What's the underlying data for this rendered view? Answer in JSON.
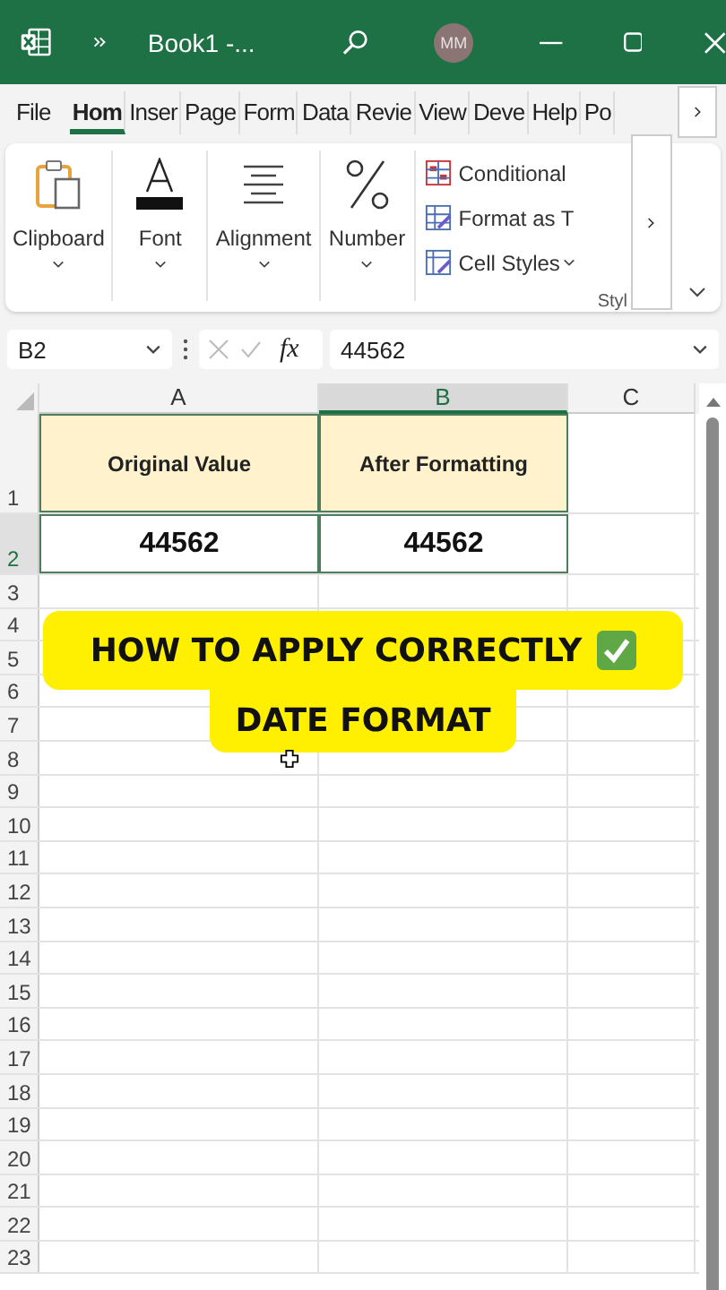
{
  "title_bar": {
    "title": "Book1 -...",
    "avatar": "MM"
  },
  "tabs": [
    {
      "label": "File",
      "selected": false
    },
    {
      "label": "Hom",
      "selected": true
    },
    {
      "label": "Inser",
      "selected": false
    },
    {
      "label": "Page",
      "selected": false
    },
    {
      "label": "Form",
      "selected": false
    },
    {
      "label": "Data",
      "selected": false
    },
    {
      "label": "Revie",
      "selected": false
    },
    {
      "label": "View",
      "selected": false
    },
    {
      "label": "Deve",
      "selected": false
    },
    {
      "label": "Help",
      "selected": false
    },
    {
      "label": "Po",
      "selected": false
    }
  ],
  "ribbon": {
    "groups": [
      {
        "label": "Clipboard",
        "kind": "clipboard"
      },
      {
        "label": "Font",
        "kind": "font"
      },
      {
        "label": "Alignment",
        "kind": "alignment"
      },
      {
        "label": "Number",
        "kind": "number"
      }
    ],
    "styles": {
      "items": [
        {
          "label": "Conditional",
          "kind": "conditional"
        },
        {
          "label": "Format as T",
          "kind": "table"
        },
        {
          "label": "Cell Styles",
          "kind": "cellstyles"
        }
      ],
      "label": "Styl"
    }
  },
  "formula_bar": {
    "name_box": "B2",
    "fx": "fx",
    "value": "44562"
  },
  "grid": {
    "columns": [
      {
        "label": "A",
        "selected": false
      },
      {
        "label": "B",
        "selected": true
      },
      {
        "label": "C",
        "selected": false
      }
    ],
    "rows": [
      {
        "label": "1",
        "kind": "header",
        "selected": false,
        "cells": [
          "Original Value",
          "After Formatting"
        ]
      },
      {
        "label": "2",
        "kind": "value",
        "selected": true,
        "cells": [
          "44562",
          "44562"
        ]
      },
      {
        "label": "3",
        "kind": "empty",
        "selected": false
      },
      {
        "label": "4",
        "kind": "empty",
        "selected": false
      },
      {
        "label": "5",
        "kind": "empty",
        "selected": false
      },
      {
        "label": "6",
        "kind": "empty",
        "selected": false
      },
      {
        "label": "7",
        "kind": "empty",
        "selected": false
      },
      {
        "label": "8",
        "kind": "empty",
        "selected": false
      },
      {
        "label": "9",
        "kind": "empty",
        "selected": false
      },
      {
        "label": "10",
        "kind": "empty",
        "selected": false
      },
      {
        "label": "11",
        "kind": "empty",
        "selected": false
      },
      {
        "label": "12",
        "kind": "empty",
        "selected": false
      },
      {
        "label": "13",
        "kind": "empty",
        "selected": false
      },
      {
        "label": "14",
        "kind": "empty",
        "selected": false
      },
      {
        "label": "15",
        "kind": "empty",
        "selected": false
      },
      {
        "label": "16",
        "kind": "empty",
        "selected": false
      },
      {
        "label": "17",
        "kind": "empty",
        "selected": false
      },
      {
        "label": "18",
        "kind": "empty",
        "selected": false
      },
      {
        "label": "19",
        "kind": "empty",
        "selected": false
      },
      {
        "label": "20",
        "kind": "empty",
        "selected": false
      },
      {
        "label": "21",
        "kind": "empty",
        "selected": false
      },
      {
        "label": "22",
        "kind": "empty",
        "selected": false
      },
      {
        "label": "23",
        "kind": "empty",
        "selected": false
      }
    ]
  },
  "caption": {
    "lines": [
      "HOW TO APPLY CORRECTLY",
      "DATE FORMAT"
    ]
  }
}
